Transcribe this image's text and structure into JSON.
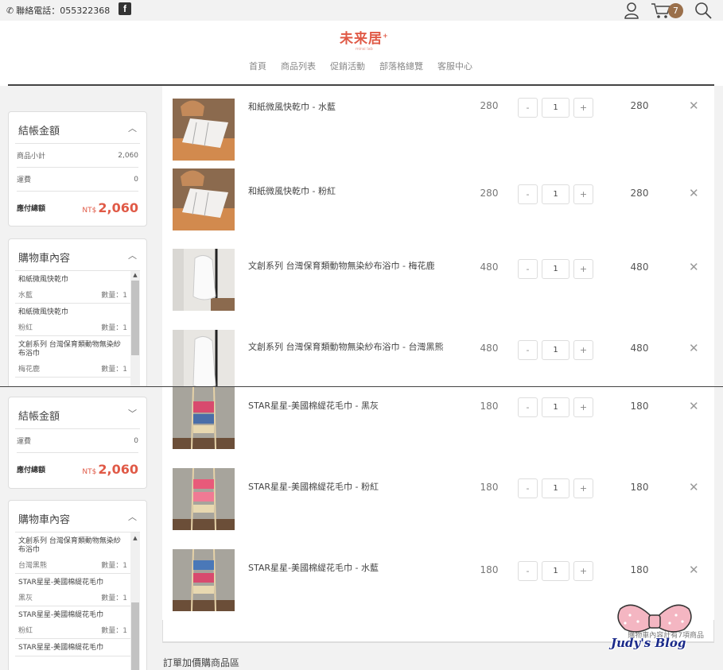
{
  "topbar": {
    "phone_label": "聯絡電話：055322368",
    "fb_letter": "f",
    "cart_count": "7"
  },
  "brand": {
    "name": "未来居",
    "tagline": "mirai lab"
  },
  "nav": [
    "首頁",
    "商品列表",
    "促銷活動",
    "部落格總覽",
    "客服中心"
  ],
  "summary_top": {
    "title": "結帳金額",
    "subtotal_label": "商品小計",
    "subtotal_value": "2,060",
    "shipping_label": "運費",
    "shipping_value": "0",
    "total_label": "應付總額",
    "currency": "NT$",
    "total_value": "2,060"
  },
  "summary_bottom": {
    "title": "結帳金額",
    "shipping_label": "運費",
    "shipping_value": "0",
    "total_label": "應付總額",
    "currency": "NT$",
    "total_value": "2,060"
  },
  "cart_panel_title": "購物車內容",
  "cart_top": [
    {
      "name": "和紙微風快乾巾",
      "variant": "水藍",
      "qty": "數量：1"
    },
    {
      "name": "和紙微風快乾巾",
      "variant": "粉紅",
      "qty": "數量：1"
    },
    {
      "name": "文創系列 台灣保育類動物無染紗布浴巾",
      "variant": "梅花鹿",
      "qty": "數量：1"
    }
  ],
  "cart_bottom": [
    {
      "name": "文創系列 台灣保育類動物無染紗布浴巾",
      "variant": "台灣黑熊",
      "qty": "數量：1"
    },
    {
      "name": "STAR星星-美國棉緹花毛巾",
      "variant": "黑灰",
      "qty": "數量：1"
    },
    {
      "name": "STAR星星-美國棉緹花毛巾",
      "variant": "粉紅",
      "qty": "數量：1"
    },
    {
      "name": "STAR星星-美國棉緹花毛巾",
      "variant": "",
      "qty": ""
    }
  ],
  "items_top": [
    {
      "name": "和紙微風快乾巾 - 水藍",
      "price": "280",
      "qty": "1",
      "subtotal": "280",
      "image": "washi-towel"
    },
    {
      "name": "和紙微風快乾巾 - 粉紅",
      "price": "280",
      "qty": "1",
      "subtotal": "280",
      "image": "washi-towel"
    },
    {
      "name": "文創系列 台灣保育類動物無染紗布浴巾 - 梅花鹿",
      "price": "480",
      "qty": "1",
      "subtotal": "480",
      "image": "gauze-towel"
    },
    {
      "name": "文創系列 台灣保育類動物無染紗布浴巾 - 台灣黑熊",
      "price": "480",
      "qty": "1",
      "subtotal": "480",
      "image": "gauze-towel"
    }
  ],
  "items_bottom": [
    {
      "name": "STAR星星-美國棉緹花毛巾 - 黑灰",
      "price": "180",
      "qty": "1",
      "subtotal": "180",
      "image": "star-towel"
    },
    {
      "name": "STAR星星-美國棉緹花毛巾 - 粉紅",
      "price": "180",
      "qty": "1",
      "subtotal": "180",
      "image": "star-towel"
    },
    {
      "name": "STAR星星-美國棉緹花毛巾 - 水藍",
      "price": "180",
      "qty": "1",
      "subtotal": "180",
      "image": "star-towel"
    }
  ],
  "qty_minus": "-",
  "qty_plus": "+",
  "remove_glyph": "✕",
  "chevron_up": "︿",
  "chevron_down": "﹀",
  "cart_note": "購物車內容計有7項商品",
  "addon_title": "訂單加價購商品區",
  "watermark": "Judy's Blog",
  "colors": {
    "accent": "#e05a47",
    "badge": "#9a6f4a"
  }
}
